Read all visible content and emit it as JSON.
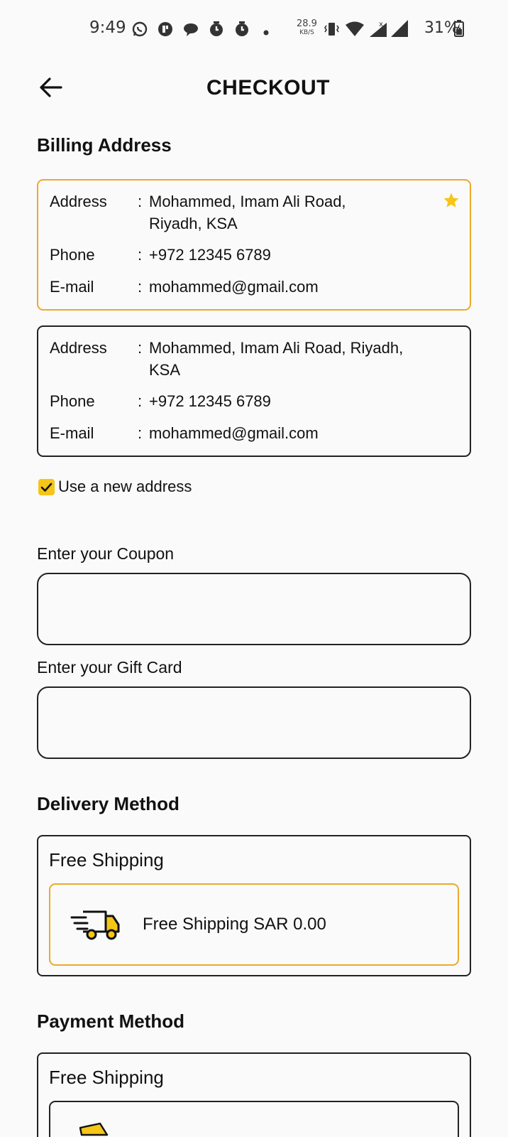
{
  "status_bar": {
    "time": "9:49",
    "net_speed": "28.9",
    "net_unit": "KB/S",
    "battery": "31%"
  },
  "header": {
    "title": "CHECKOUT"
  },
  "billing": {
    "title": "Billing Address",
    "addresses": [
      {
        "address_label": "Address",
        "address": "Mohammed, Imam Ali Road,",
        "address_line2": "Riyadh, KSA",
        "phone_label": "Phone",
        "phone": "+972 12345 6789",
        "email_label": "E-mail",
        "email": "mohammed@gmail.com",
        "default": true
      },
      {
        "address_label": "Address",
        "address": "Mohammed, Imam Ali Road, Riyadh,",
        "address_line2": "KSA",
        "phone_label": "Phone",
        "phone": "+972 12345 6789",
        "email_label": "E-mail",
        "email": "mohammed@gmail.com",
        "default": false
      }
    ],
    "separator": ":",
    "new_address_label": "Use a new address",
    "new_address_checked": true
  },
  "coupon": {
    "label": "Enter your Coupon",
    "value": ""
  },
  "gift_card": {
    "label": "Enter your Gift Card",
    "value": ""
  },
  "delivery": {
    "title": "Delivery Method",
    "group_title": "Free Shipping",
    "option_label": "Free Shipping SAR 0.00",
    "option_icon": "delivery-truck-icon"
  },
  "payment": {
    "title": "Payment Method",
    "group_title": "Free Shipping"
  },
  "colors": {
    "accent": "#eca92b",
    "checkbox": "#f5c518",
    "border": "#222222",
    "background": "#fafafa"
  }
}
